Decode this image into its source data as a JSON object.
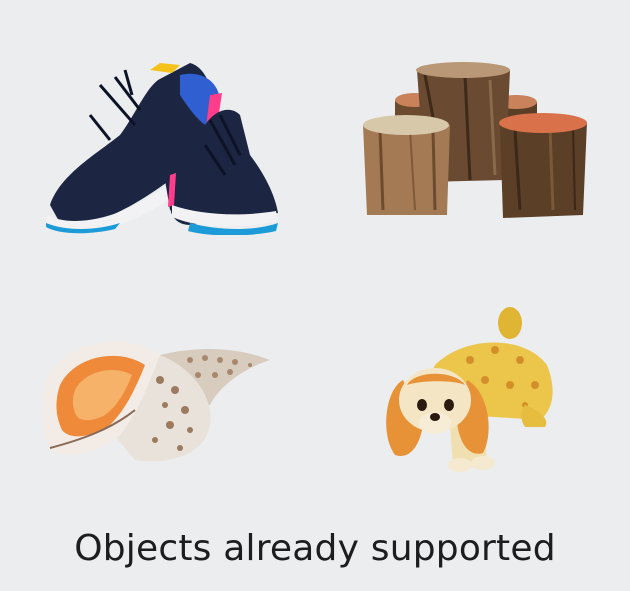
{
  "caption": "Objects already supported",
  "objects": [
    {
      "name": "sneakers",
      "icon": "sneakers-icon"
    },
    {
      "name": "tree stumps",
      "icon": "tree-stumps-icon"
    },
    {
      "name": "conch shell",
      "icon": "shell-icon"
    },
    {
      "name": "dog figurine",
      "icon": "dog-figurine-icon"
    }
  ],
  "colors": {
    "background": "#ecedef",
    "text": "#1d1d1f"
  }
}
